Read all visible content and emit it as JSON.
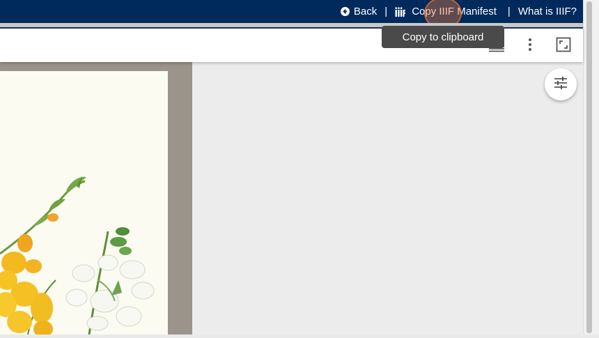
{
  "nav": {
    "back_label": "Back",
    "separator": "|",
    "copy_manifest_label": "Copy IIIF Manifest",
    "what_is_label": "What is IIIF?"
  },
  "tooltip": {
    "text": "Copy to clipboard"
  },
  "toolbar": {
    "icons": [
      "gallery-view-icon",
      "more-vert-icon",
      "fullscreen-icon"
    ]
  },
  "canvas": {
    "settings_icon": "tune-icon"
  },
  "colors": {
    "topbar": "#002a5c",
    "tooltip": "#4a4a4a",
    "canvas_bg": "#ececec"
  }
}
